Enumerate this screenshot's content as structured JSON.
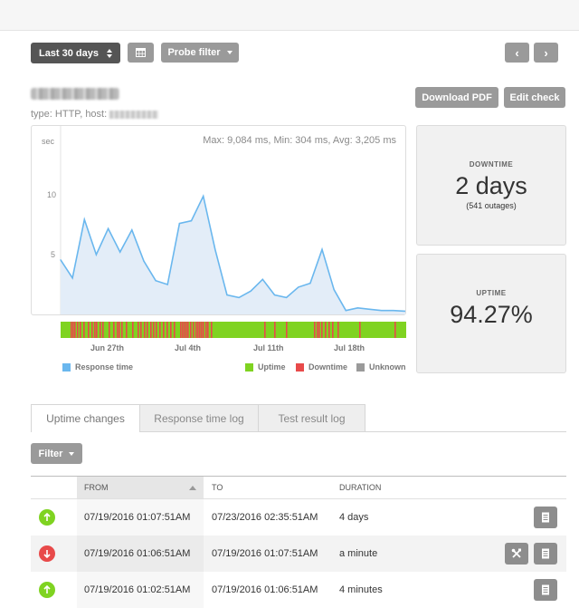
{
  "toolbar": {
    "date_range": "Last 30 days",
    "calendar_icon": "calendar-icon",
    "probe_filter": "Probe filter",
    "prev_icon": "chevron-left-icon",
    "next_icon": "chevron-right-icon"
  },
  "check": {
    "subtitle": "type: HTTP, host:",
    "download_pdf": "Download PDF",
    "edit_check": "Edit check"
  },
  "chart_data": {
    "type": "area",
    "stats": "Max: 9,084 ms, Min: 304 ms, Avg: 3,205 ms",
    "ylabel": "sec",
    "yticks": [
      "10",
      "5"
    ],
    "ylim": [
      0,
      14.5
    ],
    "x_labels": [
      "Jun 27th",
      "Jul 4th",
      "Jul 11th",
      "Jul 18th"
    ],
    "series": [
      {
        "name": "Response time",
        "x": [
          "Jun 24",
          "Jun 25",
          "Jun 26",
          "Jun 27",
          "Jun 28",
          "Jun 29",
          "Jun 30",
          "Jul 1",
          "Jul 2",
          "Jul 3",
          "Jul 4",
          "Jul 5",
          "Jul 6",
          "Jul 7",
          "Jul 8",
          "Jul 9",
          "Jul 10",
          "Jul 11",
          "Jul 12",
          "Jul 13",
          "Jul 14",
          "Jul 15",
          "Jul 16",
          "Jul 17",
          "Jul 18",
          "Jul 19",
          "Jul 20",
          "Jul 21",
          "Jul 22",
          "Jul 23"
        ],
        "values": [
          4.2,
          2.8,
          7.3,
          4.6,
          6.6,
          4.8,
          6.5,
          4.1,
          2.6,
          2.3,
          7.0,
          7.2,
          9.1,
          5.0,
          1.5,
          1.3,
          1.8,
          2.7,
          1.5,
          1.3,
          2.1,
          2.4,
          5.0,
          1.9,
          0.3,
          0.5,
          0.4,
          0.3,
          0.3,
          0.25
        ]
      }
    ],
    "uptime_bar": {
      "legend": [
        "Uptime",
        "Downtime",
        "Unknown"
      ],
      "downtime_marks_x": [
        11,
        13,
        15,
        18,
        21,
        25,
        30,
        34,
        37,
        39,
        43,
        46,
        53,
        58,
        62,
        64,
        67,
        72,
        79,
        85,
        88,
        92,
        95,
        99,
        102,
        105,
        109,
        113,
        117,
        121,
        125,
        132,
        134,
        136,
        138,
        140,
        143,
        146,
        149,
        151,
        153,
        155,
        157,
        160,
        162,
        166,
        225,
        236,
        249,
        280,
        283,
        285,
        288,
        292,
        296,
        300,
        306,
        330,
        369
      ]
    }
  },
  "legend": {
    "response_time": "Response time",
    "uptime": "Uptime",
    "downtime": "Downtime",
    "unknown": "Unknown",
    "colors": {
      "response": "#6ab7ee",
      "uptime": "#7fd321",
      "downtime": "#e84a4a",
      "unknown": "#9a9a9a"
    }
  },
  "stats": {
    "downtime_label": "DOWNTIME",
    "downtime_value": "2 days",
    "downtime_outages": "(541 outages)",
    "uptime_label": "UPTIME",
    "uptime_value": "94.27%"
  },
  "tabs": [
    {
      "label": "Uptime changes",
      "active": true
    },
    {
      "label": "Response time log",
      "active": false
    },
    {
      "label": "Test result log",
      "active": false
    }
  ],
  "filter_button": "Filter",
  "table": {
    "columns": [
      "FROM",
      "TO",
      "DURATION"
    ],
    "rows": [
      {
        "status": "up",
        "from": "07/19/2016 01:07:51AM",
        "to": "07/23/2016 02:35:51AM",
        "duration": "4 days"
      },
      {
        "status": "down",
        "from": "07/19/2016 01:06:51AM",
        "to": "07/19/2016 01:07:51AM",
        "duration": "a minute"
      },
      {
        "status": "up",
        "from": "07/19/2016 01:02:51AM",
        "to": "07/19/2016 01:06:51AM",
        "duration": "4 minutes"
      }
    ]
  }
}
